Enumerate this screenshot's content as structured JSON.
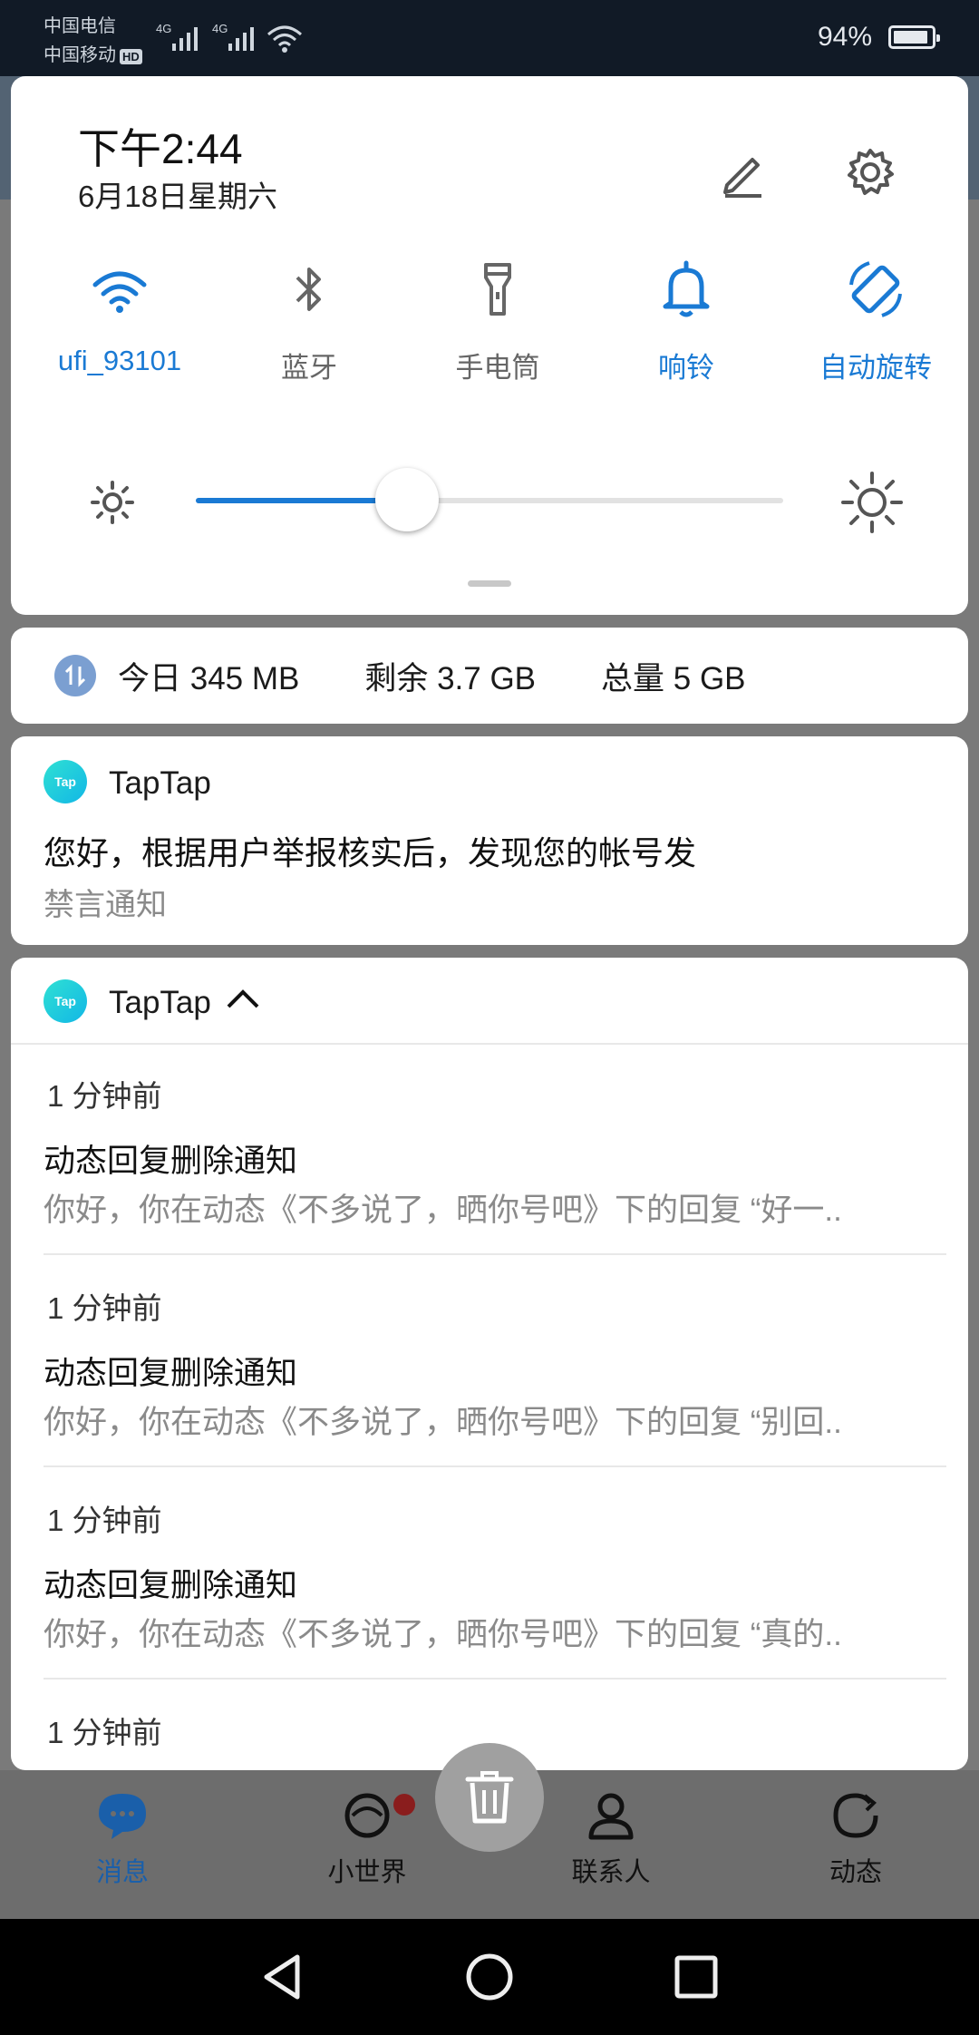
{
  "status_bar": {
    "carrier1": "中国电信",
    "carrier2": "中国移动",
    "hd_badge": "HD",
    "network1": "4G",
    "network2": "4G",
    "battery_percent": "94%",
    "battery_level": 0.94
  },
  "quick_settings": {
    "time": "下午2:44",
    "date": "6月18日星期六",
    "edit_icon": "pencil-icon",
    "settings_icon": "gear-icon",
    "toggles": [
      {
        "label": "ufi_93101",
        "icon": "wifi-icon",
        "active": true
      },
      {
        "label": "蓝牙",
        "icon": "bluetooth-icon",
        "active": false
      },
      {
        "label": "手电筒",
        "icon": "flashlight-icon",
        "active": false
      },
      {
        "label": "响铃",
        "icon": "bell-icon",
        "active": true
      },
      {
        "label": "自动旋转",
        "icon": "auto-rotate-icon",
        "active": true
      }
    ],
    "brightness_level": 0.36,
    "accent_color": "#1a7ad4"
  },
  "data_usage": {
    "today": "今日 345 MB",
    "remaining": "剩余 3.7 GB",
    "total": "总量 5 GB"
  },
  "notification_single": {
    "app_icon_text": "Tap",
    "app_name": "TapTap",
    "title": "您好，根据用户举报核实后，发现您的帐号发",
    "subtitle": "禁言通知"
  },
  "notification_group": {
    "app_icon_text": "Tap",
    "app_name": "TapTap",
    "items": [
      {
        "time": "1 分钟前",
        "title": "动态回复删除通知",
        "body": "你好，你在动态《不多说了，晒你号吧》下的回复 “好一.."
      },
      {
        "time": "1 分钟前",
        "title": "动态回复删除通知",
        "body": "你好，你在动态《不多说了，晒你号吧》下的回复 “别回.."
      },
      {
        "time": "1 分钟前",
        "title": "动态回复删除通知",
        "body": "你好，你在动态《不多说了，晒你号吧》下的回复 “真的.."
      },
      {
        "time": "1 分钟前",
        "title": "",
        "body": ""
      }
    ]
  },
  "app_nav": {
    "items": [
      {
        "label": "消息",
        "icon": "chat-icon",
        "active": true
      },
      {
        "label": "小世界",
        "icon": "world-icon",
        "active": false
      },
      {
        "label": "联系人",
        "icon": "contacts-icon",
        "active": false
      },
      {
        "label": "动态",
        "icon": "refresh-icon",
        "active": false
      }
    ]
  },
  "clear_all_icon": "trash-icon",
  "system_nav": {
    "back": "back-icon",
    "home": "home-icon",
    "recents": "recents-icon"
  }
}
